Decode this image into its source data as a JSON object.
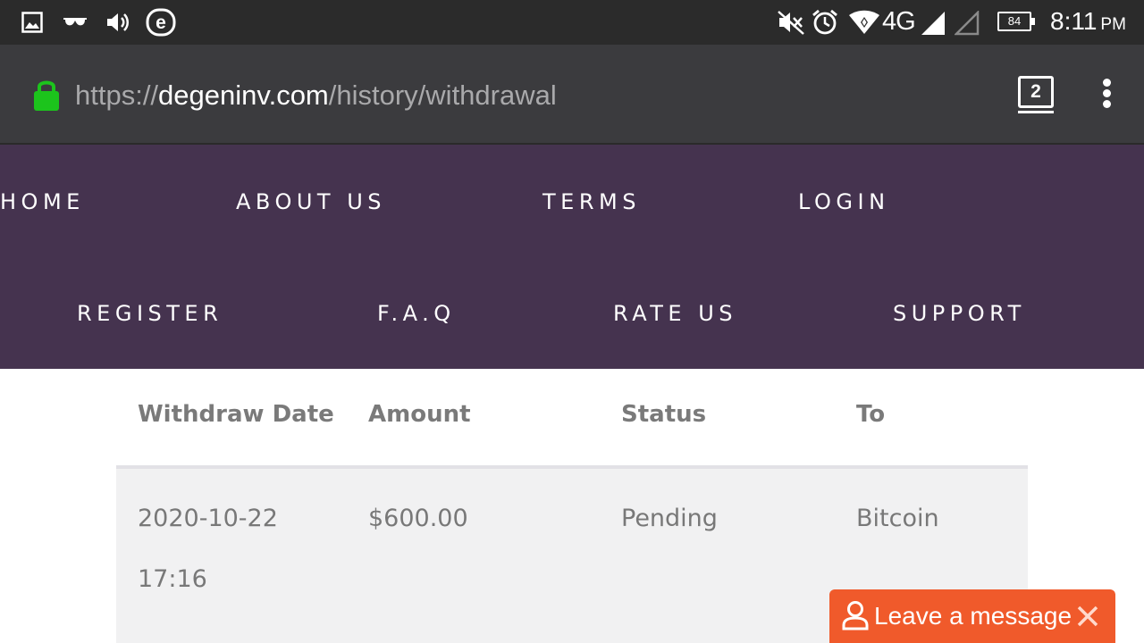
{
  "status_bar": {
    "network": "4G",
    "battery": "84",
    "time": "8:11",
    "ampm": "PM",
    "icons": [
      "image-icon",
      "glasses-icon",
      "volume-icon",
      "e-app-icon",
      "vibrate-off-icon",
      "alarm-icon",
      "wifi-icon",
      "signal-icon",
      "signal-empty-icon",
      "battery-icon"
    ]
  },
  "browser": {
    "url_scheme": "https://",
    "url_host": "degeninv.com",
    "url_path": "/history/withdrawal",
    "tab_count": "2",
    "lock_color": "#1cc41c"
  },
  "nav": {
    "row1": [
      "HOME",
      "ABOUT US",
      "TERMS",
      "LOGIN"
    ],
    "row2": [
      "REGISTER",
      "F.A.Q",
      "RATE US",
      "SUPPORT"
    ],
    "background": "#45334f"
  },
  "table": {
    "headers": [
      "Withdraw Date",
      "Amount",
      "Status",
      "To"
    ],
    "rows": [
      {
        "date": "2020-10-22",
        "time": "17:16",
        "amount": "$600.00",
        "status": "Pending",
        "to": "Bitcoin"
      }
    ]
  },
  "chat_widget": {
    "label": "Leave a message",
    "color": "#f05a2b"
  }
}
